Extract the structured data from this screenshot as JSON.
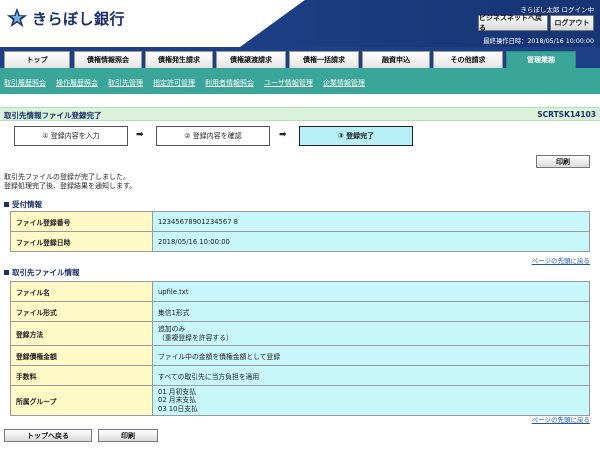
{
  "header": {
    "bank_name": "きらぼし銀行",
    "user_info": "きらぼし太郎 ログイン中",
    "business_net_button": "ビジネスネットへ戻る",
    "logout_button": "ログアウト",
    "last_operation": "最終操作日時：2018/05/16 10:00:00"
  },
  "tabs": [
    {
      "label": "トップ"
    },
    {
      "label": "債権情報照会"
    },
    {
      "label": "債権発生請求"
    },
    {
      "label": "債権譲渡請求"
    },
    {
      "label": "債権一括請求"
    },
    {
      "label": "融資申込"
    },
    {
      "label": "その他請求"
    },
    {
      "label": "管理業務",
      "active": true
    }
  ],
  "subnav": [
    {
      "label": "取引履歴照会"
    },
    {
      "label": "操作履歴照会"
    },
    {
      "label": "取引先管理"
    },
    {
      "label": "指定許可管理"
    },
    {
      "label": "利用者情報照会"
    },
    {
      "label": "ユーザ情報管理"
    },
    {
      "label": "企業情報管理"
    }
  ],
  "page": {
    "title": "取引先情報ファイル登録完了",
    "screen_id": "SCRTSK14103"
  },
  "steps": [
    {
      "label": "① 登録内容を入力"
    },
    {
      "label": "② 登録内容を確認"
    },
    {
      "label": "③ 登録完了",
      "current": true
    }
  ],
  "print_button": "印刷",
  "message": {
    "line1": "取引先ファイルの登録が完了しました。",
    "line2": "登録処理完了後、登録結果を通知します。"
  },
  "reception": {
    "heading": "受付情報",
    "rows": [
      {
        "label": "ファイル登録番号",
        "value": "12345678901234567 8"
      },
      {
        "label": "ファイル登録日時",
        "value": "2018/05/16 10:00:00"
      }
    ]
  },
  "file_info": {
    "heading": "取引先ファイル情報",
    "file_name_label": "ファイル名",
    "file_name": "upfile.txt",
    "file_format_label": "ファイル形式",
    "file_format": "集信1形式",
    "method_label": "登録方法",
    "method_line1": "追加のみ",
    "method_line2": "（重複登録を許容する）",
    "amount_label": "登録債権金額",
    "amount": "ファイル中の金額を債権金額として登録",
    "fee_label": "手数料",
    "fee": "すべての取引先に当方負担を適用",
    "group_label": "所属グループ",
    "group_line1": "01 月初支払",
    "group_line2": "02 月末支払",
    "group_line3": "03 10日支払"
  },
  "page_top_link": "ページの先頭に戻る",
  "footer": {
    "top_button": "トップへ戻る",
    "print_button": "印刷"
  },
  "colors": {
    "brand_navy": "#1d3f86",
    "accent_teal": "#3aa69a",
    "label_yellow": "#fff9c8",
    "value_cyan": "#c8f7fb"
  }
}
